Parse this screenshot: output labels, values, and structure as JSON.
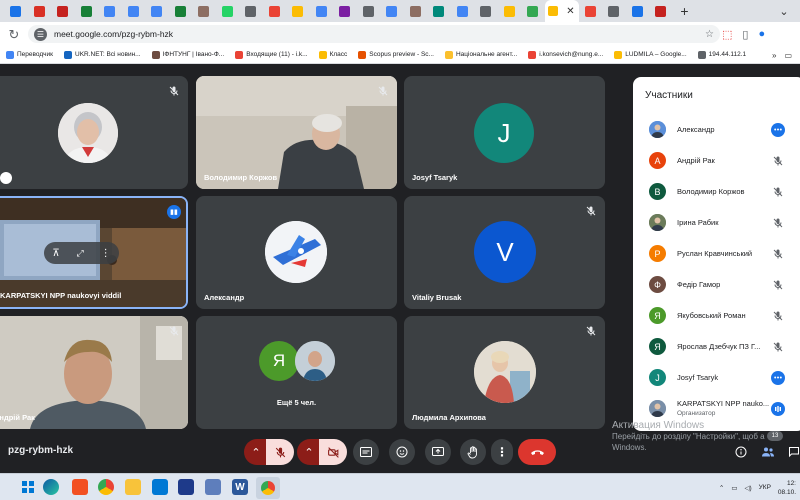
{
  "browser": {
    "tabs": [
      {
        "fav": "#1a73e8"
      },
      {
        "fav": "#d93025"
      },
      {
        "fav": "#c5221f"
      },
      {
        "fav": "#188038"
      },
      {
        "fav": "#4285f4"
      },
      {
        "fav": "#4285f4"
      },
      {
        "fav": "#4285f4"
      },
      {
        "fav": "#188038"
      },
      {
        "fav": "#8d6e63"
      },
      {
        "fav": "#25d366"
      },
      {
        "fav": "#5f6368"
      },
      {
        "fav": "#ea4335"
      },
      {
        "fav": "#fbbc04"
      },
      {
        "fav": "#4285f4"
      },
      {
        "fav": "#7b1fa2"
      },
      {
        "fav": "#5f6368"
      },
      {
        "fav": "#4285f4"
      },
      {
        "fav": "#8d6e63"
      },
      {
        "fav": "#00897b"
      },
      {
        "fav": "#4285f4"
      },
      {
        "fav": "#5f6368"
      },
      {
        "fav": "#fbbc04"
      },
      {
        "fav": "#34a853"
      }
    ],
    "active_tab_close": "✕",
    "tabs_after": [
      {
        "fav": "#ea4335"
      },
      {
        "fav": "#5f6368"
      },
      {
        "fav": "#1a73e8"
      },
      {
        "fav": "#c5221f"
      }
    ],
    "new_tab": "+",
    "url": "meet.google.com/pzg-rybm-hzk",
    "bookmarks": [
      {
        "label": "Переводчик",
        "color": "#4285f4"
      },
      {
        "label": "UKR.NET: Всі новин...",
        "color": "#1565c0"
      },
      {
        "label": "ІФНТУНГ | Івано-Ф...",
        "color": "#6d4c41"
      },
      {
        "label": "Входящие (11) - i.k...",
        "color": "#ea4335"
      },
      {
        "label": "Класс",
        "color": "#fbbc04"
      },
      {
        "label": "Scopus preview - Sc...",
        "color": "#e65100"
      },
      {
        "label": "Національне агент...",
        "color": "#fbc02d"
      },
      {
        "label": "i.konsevich@nung.e...",
        "color": "#ea4335"
      },
      {
        "label": "LUDMILA – Google...",
        "color": "#fbbc04"
      },
      {
        "label": "194.44.112.1",
        "color": "#5f6368"
      }
    ],
    "bookmarks_more": "»"
  },
  "meet": {
    "tiles": [
      {
        "name": ""
      },
      {
        "name": "Володимир Коржов"
      },
      {
        "name": "Josyf Tsaryk",
        "initial": "J",
        "color": "#12877a"
      },
      {
        "name": "KARPATSKYI NPP naukovyi viddil"
      },
      {
        "name": "Александр"
      },
      {
        "name": "Vitaliy Brusak",
        "initial": "V",
        "color": "#0b57d0"
      },
      {
        "name": "Андрій Рак"
      },
      {
        "name": "Ещё 5 чел.",
        "initial": "Я",
        "color": "#4c9a2a"
      },
      {
        "name": "Людмила Архипова"
      }
    ],
    "meeting_code": "pzg-rybm-hzk",
    "more_count": "13"
  },
  "panel": {
    "title": "Участники",
    "participants": [
      {
        "name": "Александр",
        "initial": "",
        "color": "#5b8fd9",
        "icon": "more-options-icon"
      },
      {
        "name": "Андрій Рак",
        "initial": "А",
        "color": "#e8430c",
        "icon": "mic-off-icon"
      },
      {
        "name": "Володимир Коржов",
        "initial": "В",
        "color": "#0f5a3e",
        "icon": "mic-off-icon"
      },
      {
        "name": "Ірина Рабик",
        "initial": "",
        "color": "#6b7b5a",
        "icon": "mic-off-icon"
      },
      {
        "name": "Руслан Кравчинський",
        "initial": "Р",
        "color": "#f57c00",
        "icon": "mic-off-icon"
      },
      {
        "name": "Федір Гамор",
        "initial": "Ф",
        "color": "#6d4c41",
        "icon": "mic-off-icon"
      },
      {
        "name": "Якубовський Роман",
        "initial": "Я",
        "color": "#4c9a2a",
        "icon": "mic-off-icon"
      },
      {
        "name": "Ярослав Дзебчук ПЗ Г...",
        "initial": "Я",
        "color": "#0f5a3e",
        "icon": "mic-off-icon"
      },
      {
        "name": "Josyf Tsaryk",
        "initial": "J",
        "color": "#12877a",
        "icon": "more-options-icon"
      },
      {
        "name": "KARPATSKYI NPP nauko...",
        "sub": "Организатор",
        "initial": "",
        "color": "#7a8fa8",
        "icon": "speaking-icon"
      }
    ]
  },
  "watermark": {
    "title": "Активация Windows",
    "line1": "Перейдіть до розділу \"Настройки\", щоб а",
    "line2": "Windows."
  },
  "taskbar": {
    "lang": "УКР",
    "time": "12:",
    "date": "08.10."
  }
}
